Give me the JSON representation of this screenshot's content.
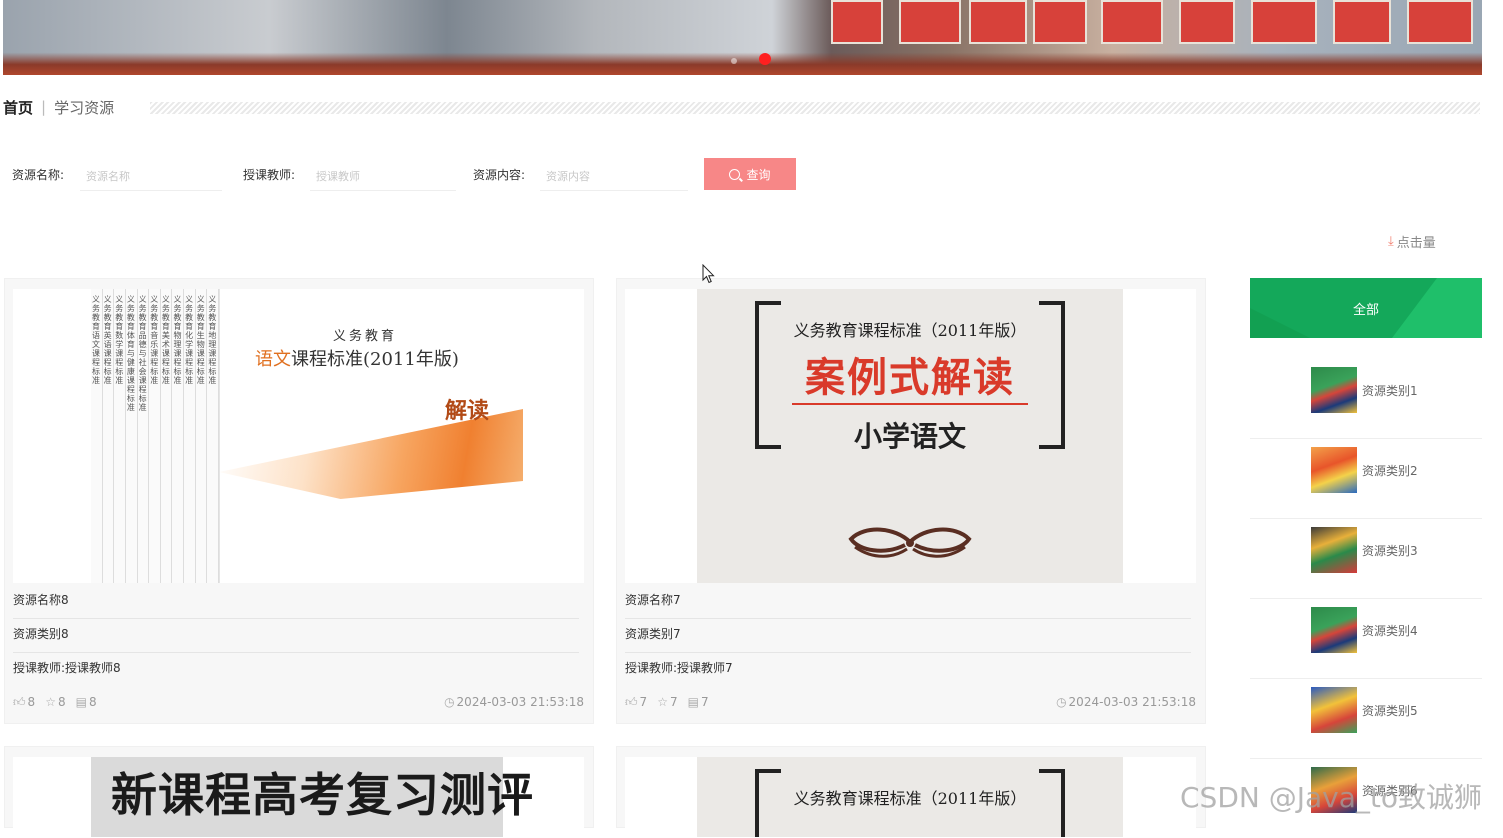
{
  "banner": {
    "slide_count": 2,
    "active_slide": 1
  },
  "breadcrumb": {
    "home": "首页",
    "separator": "|",
    "current": "学习资源"
  },
  "search": {
    "name_label": "资源名称:",
    "name_placeholder": "资源名称",
    "teacher_label": "授课教师:",
    "teacher_placeholder": "授课教师",
    "content_label": "资源内容:",
    "content_placeholder": "资源内容",
    "button_label": "查询"
  },
  "sort": {
    "label": "点击量"
  },
  "cards": [
    {
      "name": "资源名称8",
      "category": "资源类别8",
      "teacher": "授课教师:授课教师8",
      "likes": "8",
      "favorites": "8",
      "comments": "8",
      "time": "2024-03-03 21:53:18",
      "cover": {
        "series": "义务教育",
        "title_highlight": "语文",
        "title_rest": "课程标准(2011年版)",
        "subtitle": "解读",
        "spines": [
          "义务教育语文课程标准",
          "义务教育英语课程标准",
          "义务教育数学课程标准",
          "义务教育体育与健康课程标准",
          "义务教育品德与社会课程标准",
          "义务教育音乐课程标准",
          "义务教育美术课程标准",
          "义务教育物理课程标准",
          "义务教育化学课程标准",
          "义务教育生物课程标准",
          "义务教育地理课程标准"
        ]
      }
    },
    {
      "name": "资源名称7",
      "category": "资源类别7",
      "teacher": "授课教师:授课教师7",
      "likes": "7",
      "favorites": "7",
      "comments": "7",
      "time": "2024-03-03 21:53:18",
      "cover": {
        "title": "义务教育课程标准（2011年版）",
        "big": "案例式解读",
        "sub": "小学语文"
      }
    }
  ],
  "partial_cards": [
    {
      "cover_text": "新课程高考复习测评"
    },
    {
      "cover_text": "义务教育课程标准（2011年版）"
    }
  ],
  "sidebar": {
    "header": "全部",
    "items": [
      {
        "label": "资源类别1"
      },
      {
        "label": "资源类别2"
      },
      {
        "label": "资源类别3"
      },
      {
        "label": "资源类别4"
      },
      {
        "label": "资源类别5"
      },
      {
        "label": "资源类别6"
      }
    ]
  },
  "watermark": "CSDN @Java_to致诚狮",
  "colors": {
    "accent": "#f78787",
    "sidebar_green": "#14a85a",
    "dot_active": "#ff2020"
  }
}
